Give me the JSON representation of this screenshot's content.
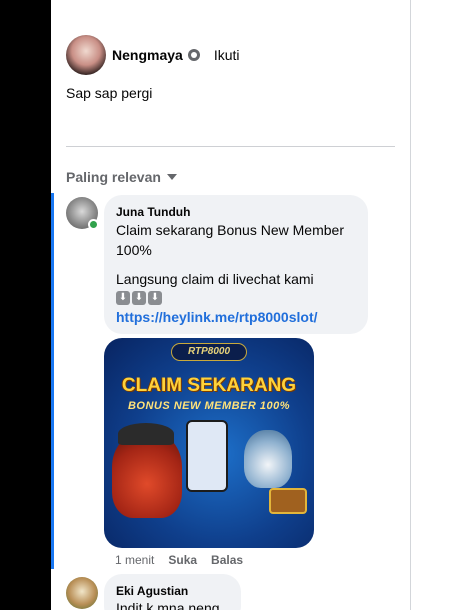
{
  "post": {
    "author": "Nengmaya",
    "follow": "Ikuti",
    "text": "Sap sap pergi"
  },
  "comments_section": {
    "sort_label": "Paling relevan"
  },
  "comments": [
    {
      "author": "Juna Tunduh",
      "text1": "Claim sekarang Bonus New Member 100%",
      "text2": "Langsung claim di livechat kami",
      "arrows": [
        "⬇",
        "⬇",
        "⬇"
      ],
      "link": "https://heylink.me/rtp8000slot/",
      "image": {
        "logo": "RTP8000",
        "title": "CLAIM SEKARANG",
        "subtitle": "BONUS NEW MEMBER 100%"
      },
      "time": "1 menit",
      "like_label": "Suka",
      "reply_label": "Balas"
    },
    {
      "author": "Eki Agustian",
      "text": "Indit k mna neng"
    }
  ],
  "colors": {
    "thread_line": "#1877f2",
    "link": "#216fdb",
    "online": "#31a24c",
    "bubble_bg": "#f0f2f5"
  },
  "icons": {
    "privacy": "globe-icon",
    "sort": "caret-down-icon",
    "arrows": "arrow-down-icon"
  }
}
